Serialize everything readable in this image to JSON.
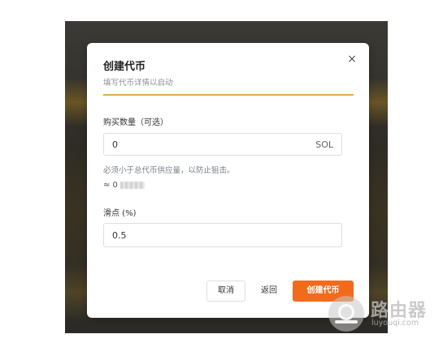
{
  "dialog": {
    "title": "创建代币",
    "subtitle": "填写代币详情以启动",
    "close_glyph": "×",
    "close_icon": "close-icon"
  },
  "buy_amount": {
    "label": "购买数量（可选）",
    "value": "0",
    "suffix": "SOL",
    "hint": "必须小于总代币供应量，以防止狙击。",
    "approx_prefix": "≈ 0"
  },
  "slippage": {
    "label": "滑点 (%)",
    "value": "0.5"
  },
  "buttons": {
    "cancel": "取消",
    "back": "返回",
    "create": "创建代币"
  },
  "watermark": {
    "name": "路由器",
    "url": "luyouqi.com"
  },
  "colors": {
    "accent_rule": "#d9b04a",
    "primary_button": "#f26b1d"
  }
}
